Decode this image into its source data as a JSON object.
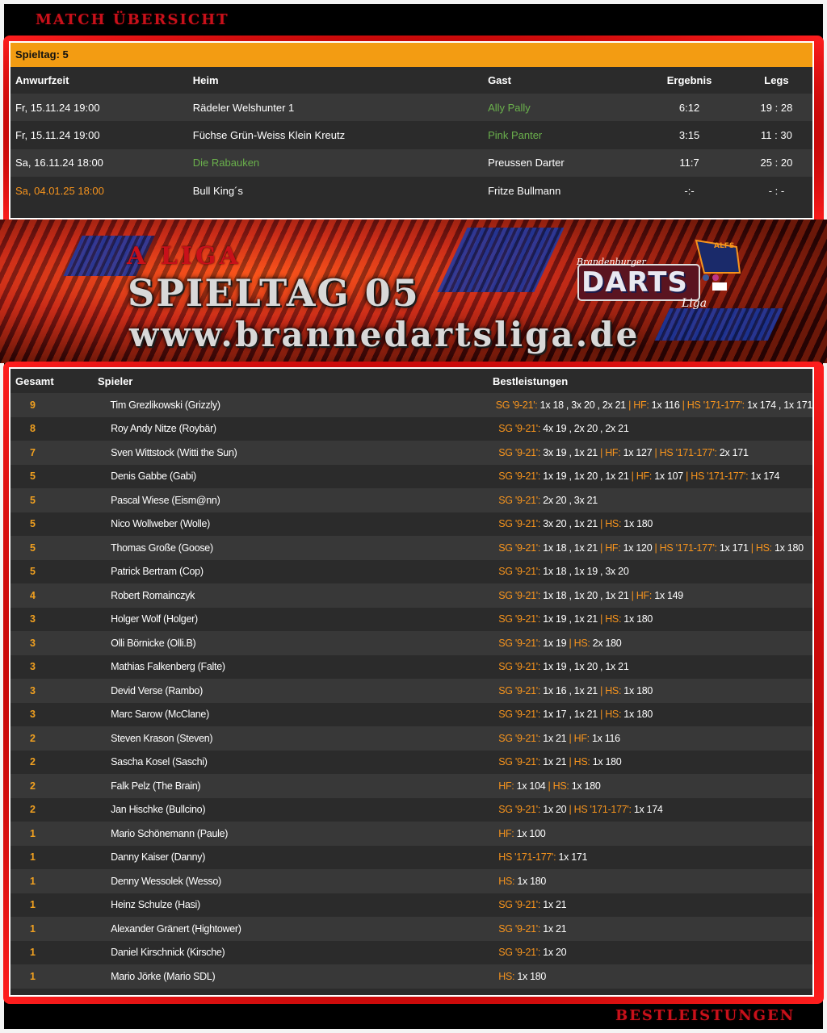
{
  "page": {
    "top_banner_title": "MATCH ÜBERSICHT",
    "bottom_banner_title": "BESTLEISTUNGEN"
  },
  "matches": {
    "spieltag_label": "Spieltag: 5",
    "headers": {
      "time": "Anwurfzeit",
      "home": "Heim",
      "guest": "Gast",
      "result": "Ergebnis",
      "legs": "Legs"
    },
    "rows": [
      {
        "time": "Fr, 15.11.24 19:00",
        "home": "Rädeler Welshunter 1",
        "guest": "Ally Pally",
        "result": "6:12",
        "legs": "19 : 28",
        "winner": "guest",
        "pending": false
      },
      {
        "time": "Fr, 15.11.24 19:00",
        "home": "Füchse Grün-Weiss Klein Kreutz",
        "guest": "Pink Panter",
        "result": "3:15",
        "legs": "11 : 30",
        "winner": "guest",
        "pending": false
      },
      {
        "time": "Sa, 16.11.24 18:00",
        "home": "Die Rabauken",
        "guest": "Preussen Darter",
        "result": "11:7",
        "legs": "25 : 20",
        "winner": "home",
        "pending": false
      },
      {
        "time": "Sa, 04.01.25 18:00",
        "home": "Bull King´s",
        "guest": "Fritze Bullmann",
        "result": "-:-",
        "legs": "- : -",
        "winner": "",
        "pending": true
      }
    ]
  },
  "banner": {
    "league": "A LIGA",
    "spieltag": "SPIELTAG 05",
    "website": "www.brannedartsliga.de",
    "logo_main": "DARTS",
    "logo_script_top": "Brandenburger",
    "logo_script_bottom": "Liga",
    "logo_badge": "ALFS"
  },
  "players": {
    "headers": {
      "total": "Gesamt",
      "player": "Spieler",
      "best": "Bestleistungen"
    },
    "rows": [
      {
        "total": "9",
        "name": "Tim Grezlikowski (Grizzly)",
        "best": [
          [
            "SG '9-21':",
            " 1x 18 , 3x 20 , 2x 21 "
          ],
          [
            "HF:",
            " 1x 116 "
          ],
          [
            "HS '171-177':",
            " 1x 174 , 1x 171"
          ]
        ]
      },
      {
        "total": "8",
        "name": "Roy Andy Nitze (Roybär)",
        "best": [
          [
            "SG '9-21':",
            " 4x 19 , 2x 20 , 2x 21"
          ]
        ]
      },
      {
        "total": "7",
        "name": "Sven Wittstock (Witti the Sun)",
        "best": [
          [
            "SG '9-21':",
            " 3x 19 , 1x 21 "
          ],
          [
            "HF:",
            " 1x 127 "
          ],
          [
            "HS '171-177':",
            " 2x 171"
          ]
        ]
      },
      {
        "total": "5",
        "name": "Denis Gabbe (Gabi)",
        "best": [
          [
            "SG '9-21':",
            " 1x 19 , 1x 20 , 1x 21 "
          ],
          [
            "HF:",
            " 1x 107 "
          ],
          [
            "HS '171-177':",
            " 1x 174"
          ]
        ]
      },
      {
        "total": "5",
        "name": "Pascal Wiese (Eism@nn)",
        "best": [
          [
            "SG '9-21':",
            " 2x 20 , 3x 21"
          ]
        ]
      },
      {
        "total": "5",
        "name": "Nico Wollweber (Wolle)",
        "best": [
          [
            "SG '9-21':",
            " 3x 20 , 1x 21 "
          ],
          [
            "HS:",
            " 1x 180"
          ]
        ]
      },
      {
        "total": "5",
        "name": "Thomas Große (Goose)",
        "best": [
          [
            "SG '9-21':",
            " 1x 18 , 1x 21 "
          ],
          [
            "HF:",
            " 1x 120 "
          ],
          [
            "HS '171-177':",
            " 1x 171 "
          ],
          [
            "HS:",
            " 1x 180"
          ]
        ]
      },
      {
        "total": "5",
        "name": "Patrick Bertram (Cop)",
        "best": [
          [
            "SG '9-21':",
            " 1x 18 , 1x 19 , 3x 20"
          ]
        ]
      },
      {
        "total": "4",
        "name": "Robert Romainczyk",
        "best": [
          [
            "SG '9-21':",
            " 1x 18 , 1x 20 , 1x 21 "
          ],
          [
            "HF:",
            " 1x 149"
          ]
        ]
      },
      {
        "total": "3",
        "name": "Holger Wolf (Holger)",
        "best": [
          [
            "SG '9-21':",
            " 1x 19 , 1x 21 "
          ],
          [
            "HS:",
            " 1x 180"
          ]
        ]
      },
      {
        "total": "3",
        "name": "Olli Börnicke (Olli.B)",
        "best": [
          [
            "SG '9-21':",
            " 1x 19 "
          ],
          [
            "HS:",
            " 2x 180"
          ]
        ]
      },
      {
        "total": "3",
        "name": "Mathias Falkenberg (Falte)",
        "best": [
          [
            "SG '9-21':",
            " 1x 19 , 1x 20 , 1x 21"
          ]
        ]
      },
      {
        "total": "3",
        "name": "Devid Verse (Rambo)",
        "best": [
          [
            "SG '9-21':",
            " 1x 16 , 1x 21 "
          ],
          [
            "HS:",
            " 1x 180"
          ]
        ]
      },
      {
        "total": "3",
        "name": "Marc Sarow (McClane)",
        "best": [
          [
            "SG '9-21':",
            " 1x 17 , 1x 21 "
          ],
          [
            "HS:",
            " 1x 180"
          ]
        ]
      },
      {
        "total": "2",
        "name": "Steven Krason (Steven)",
        "best": [
          [
            "SG '9-21':",
            " 1x 21 "
          ],
          [
            "HF:",
            " 1x 116"
          ]
        ]
      },
      {
        "total": "2",
        "name": "Sascha Kosel (Saschi)",
        "best": [
          [
            "SG '9-21':",
            " 1x 21 "
          ],
          [
            "HS:",
            " 1x 180"
          ]
        ]
      },
      {
        "total": "2",
        "name": "Falk Pelz (The Brain)",
        "best": [
          [
            "HF:",
            " 1x 104 "
          ],
          [
            "HS:",
            " 1x 180"
          ]
        ]
      },
      {
        "total": "2",
        "name": "Jan Hischke (Bullcino)",
        "best": [
          [
            "SG '9-21':",
            " 1x 20 "
          ],
          [
            "HS '171-177':",
            " 1x 174"
          ]
        ]
      },
      {
        "total": "1",
        "name": "Mario Schönemann (Paule)",
        "best": [
          [
            "HF:",
            " 1x 100"
          ]
        ]
      },
      {
        "total": "1",
        "name": "Danny Kaiser (Danny)",
        "best": [
          [
            "HS '171-177':",
            " 1x 171"
          ]
        ]
      },
      {
        "total": "1",
        "name": "Denny Wessolek (Wesso)",
        "best": [
          [
            "HS:",
            " 1x 180"
          ]
        ]
      },
      {
        "total": "1",
        "name": "Heinz Schulze (Hasi)",
        "best": [
          [
            "SG '9-21':",
            " 1x 21"
          ]
        ]
      },
      {
        "total": "1",
        "name": "Alexander Gränert (Hightower)",
        "best": [
          [
            "SG '9-21':",
            " 1x 21"
          ]
        ]
      },
      {
        "total": "1",
        "name": "Daniel Kirschnick (Kirsche)",
        "best": [
          [
            "SG '9-21':",
            " 1x 20"
          ]
        ]
      },
      {
        "total": "1",
        "name": "Mario Jörke (Mario SDL)",
        "best": [
          [
            "HS:",
            " 1x 180"
          ]
        ]
      }
    ]
  },
  "colors": {
    "accent_orange": "#f39c12",
    "label_orange": "#f7941d",
    "winner_green": "#6ab04c",
    "title_red": "#c8101a",
    "table_bg": "#2b2b2b"
  }
}
